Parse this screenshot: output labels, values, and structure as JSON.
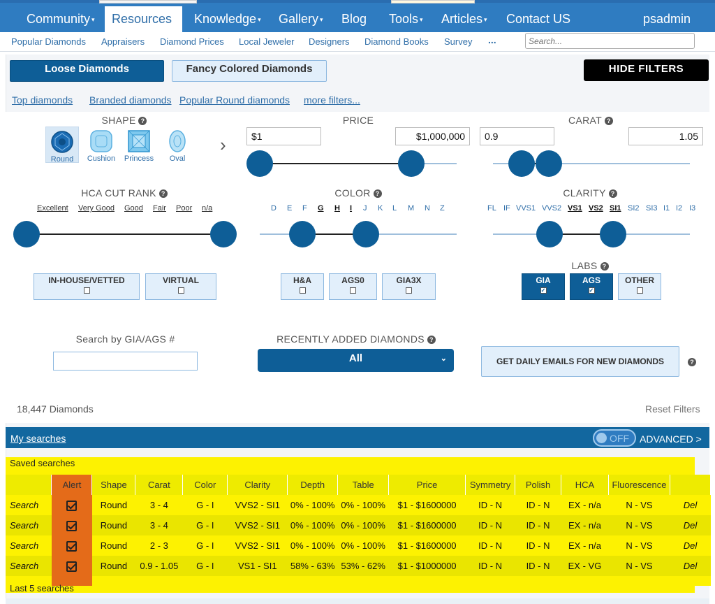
{
  "nav": {
    "items": [
      {
        "label": "Community",
        "caret": "▾"
      },
      {
        "label": "Resources",
        "caret": ""
      },
      {
        "label": "Knowledge",
        "caret": "▾"
      },
      {
        "label": "Gallery",
        "caret": "▾"
      },
      {
        "label": "Blog",
        "caret": ""
      },
      {
        "label": "Tools",
        "caret": "▾"
      },
      {
        "label": "Articles",
        "caret": "▾"
      },
      {
        "label": "Contact US",
        "caret": ""
      }
    ],
    "user": "psadmin",
    "active": "Resources"
  },
  "subnav": {
    "items": [
      "Popular Diamonds",
      "Appraisers",
      "Diamond Prices",
      "Local Jeweler",
      "Designers",
      "Diamond Books",
      "Survey",
      "..."
    ],
    "search_placeholder": "Search..."
  },
  "tabs": {
    "loose": "Loose Diamonds",
    "fancy": "Fancy Colored Diamonds",
    "hide_filters": "HIDE FILTERS"
  },
  "filter_links": [
    "Top diamonds",
    "Branded diamonds",
    "Popular Round diamonds",
    "more filters..."
  ],
  "shape": {
    "heading": "SHAPE",
    "options": [
      "Round",
      "Cushion",
      "Princess",
      "Oval"
    ],
    "selected": "Round",
    "next_arrow": "›"
  },
  "price": {
    "heading": "PRICE",
    "min": "$1",
    "max": "$1,000,000"
  },
  "carat": {
    "heading": "CARAT",
    "min": "0.9",
    "max": "1.05"
  },
  "cut": {
    "heading": "HCA CUT RANK",
    "grades": [
      "Excellent",
      "Very Good",
      "Good",
      "Fair",
      "Poor",
      "n/a"
    ]
  },
  "color": {
    "heading": "COLOR",
    "grades": [
      "D",
      "E",
      "F",
      "G",
      "H",
      "I",
      "J",
      "K",
      "L",
      "M",
      "N",
      "Z"
    ],
    "selected": [
      "G",
      "H",
      "I"
    ]
  },
  "clarity": {
    "heading": "CLARITY",
    "grades": [
      "FL",
      "IF",
      "VVS1",
      "VVS2",
      "VS1",
      "VS2",
      "SI1",
      "SI2",
      "SI3",
      "I1",
      "I2",
      "I3"
    ],
    "selected": [
      "VS1",
      "VS2",
      "SI1"
    ]
  },
  "checkboxes": {
    "inhouse": "IN-HOUSE/VETTED",
    "virtual": "VIRTUAL",
    "ha": "H&A",
    "ags0": "AGS0",
    "gia3x": "GIA3X"
  },
  "labs": {
    "heading": "LABS",
    "options": [
      {
        "label": "GIA",
        "checked": true
      },
      {
        "label": "AGS",
        "checked": true
      },
      {
        "label": "OTHER",
        "checked": false
      }
    ]
  },
  "gia_search": {
    "label": "Search by GIA/AGS #",
    "value": ""
  },
  "recent": {
    "label": "RECENTLY ADDED DIAMONDS",
    "value": "All"
  },
  "daily_emails": "GET DAILY EMAILS FOR NEW DIAMONDS",
  "count": "18,447 Diamonds",
  "reset": "Reset Filters",
  "my_searches": {
    "label": "My searches",
    "toggle": "OFF",
    "advanced": "ADVANCED >"
  },
  "saved": {
    "title": "Saved searches",
    "columns": [
      "",
      "Alert",
      "Shape",
      "Carat",
      "Color",
      "Clarity",
      "Depth",
      "Table",
      "Price",
      "Symmetry",
      "Polish",
      "HCA",
      "Fluorescence",
      ""
    ],
    "rows": [
      {
        "action": "Search",
        "shape": "Round",
        "carat": "3 - 4",
        "color": "G - I",
        "clarity": "VVS2 - SI1",
        "depth": "0% - 100%",
        "table": "0% - 100%",
        "price": "$1 - $1600000",
        "symmetry": "ID - N",
        "polish": "ID - N",
        "hca": "EX - n/a",
        "fluor": "N - VS",
        "del": "Del"
      },
      {
        "action": "Search",
        "shape": "Round",
        "carat": "3 - 4",
        "color": "G - I",
        "clarity": "VVS2 - SI1",
        "depth": "0% - 100%",
        "table": "0% - 100%",
        "price": "$1 - $1600000",
        "symmetry": "ID - N",
        "polish": "ID - N",
        "hca": "EX - n/a",
        "fluor": "N - VS",
        "del": "Del"
      },
      {
        "action": "Search",
        "shape": "Round",
        "carat": "2 - 3",
        "color": "G - I",
        "clarity": "VVS2 - SI1",
        "depth": "0% - 100%",
        "table": "0% - 100%",
        "price": "$1 - $1600000",
        "symmetry": "ID - N",
        "polish": "ID - N",
        "hca": "EX - n/a",
        "fluor": "N - VS",
        "del": "Del"
      },
      {
        "action": "Search",
        "shape": "Round",
        "carat": "0.9 - 1.05",
        "color": "G - I",
        "clarity": "VS1 - SI1",
        "depth": "58% - 63%",
        "table": "53% - 62%",
        "price": "$1 - $1000000",
        "symmetry": "ID - N",
        "polish": "ID - N",
        "hca": "EX - VG",
        "fluor": "N - VS",
        "del": "Del"
      }
    ],
    "last_label": "Last 5 searches"
  },
  "colors": {
    "brand": "#2f7cc1",
    "dark_blue": "#0e5e97",
    "highlight": "#fdf201",
    "alert": "#e46b19"
  }
}
